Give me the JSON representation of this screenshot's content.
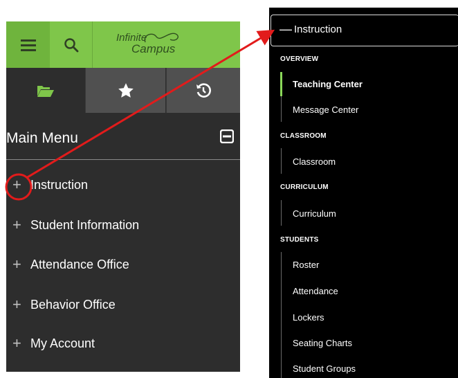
{
  "logo": {
    "line1": "Infinite",
    "line2": "Campus"
  },
  "main_menu": {
    "title": "Main Menu",
    "items": [
      {
        "label": "Instruction"
      },
      {
        "label": "Student Information"
      },
      {
        "label": "Attendance Office"
      },
      {
        "label": "Behavior Office"
      },
      {
        "label": "My Account"
      }
    ]
  },
  "instruction_panel": {
    "header": "Instruction",
    "sections": [
      {
        "title": "OVERVIEW",
        "items": [
          {
            "label": "Teaching Center",
            "active": true
          },
          {
            "label": "Message Center"
          }
        ]
      },
      {
        "title": "CLASSROOM",
        "items": [
          {
            "label": "Classroom"
          }
        ]
      },
      {
        "title": "CURRICULUM",
        "items": [
          {
            "label": "Curriculum"
          }
        ]
      },
      {
        "title": "STUDENTS",
        "items": [
          {
            "label": "Roster"
          },
          {
            "label": "Attendance"
          },
          {
            "label": "Lockers"
          },
          {
            "label": "Seating Charts"
          },
          {
            "label": "Student Groups"
          }
        ]
      }
    ]
  },
  "colors": {
    "topbar_green": "#7fc64a",
    "panel_dark": "#2d2d2d",
    "annotation_red": "#e21b1b",
    "active_indicator": "#8bd85a"
  },
  "icons": [
    "hamburger-icon",
    "search-icon",
    "folder-open-icon",
    "star-icon",
    "history-icon",
    "collapse-icon",
    "plus-icon",
    "minus-icon"
  ]
}
